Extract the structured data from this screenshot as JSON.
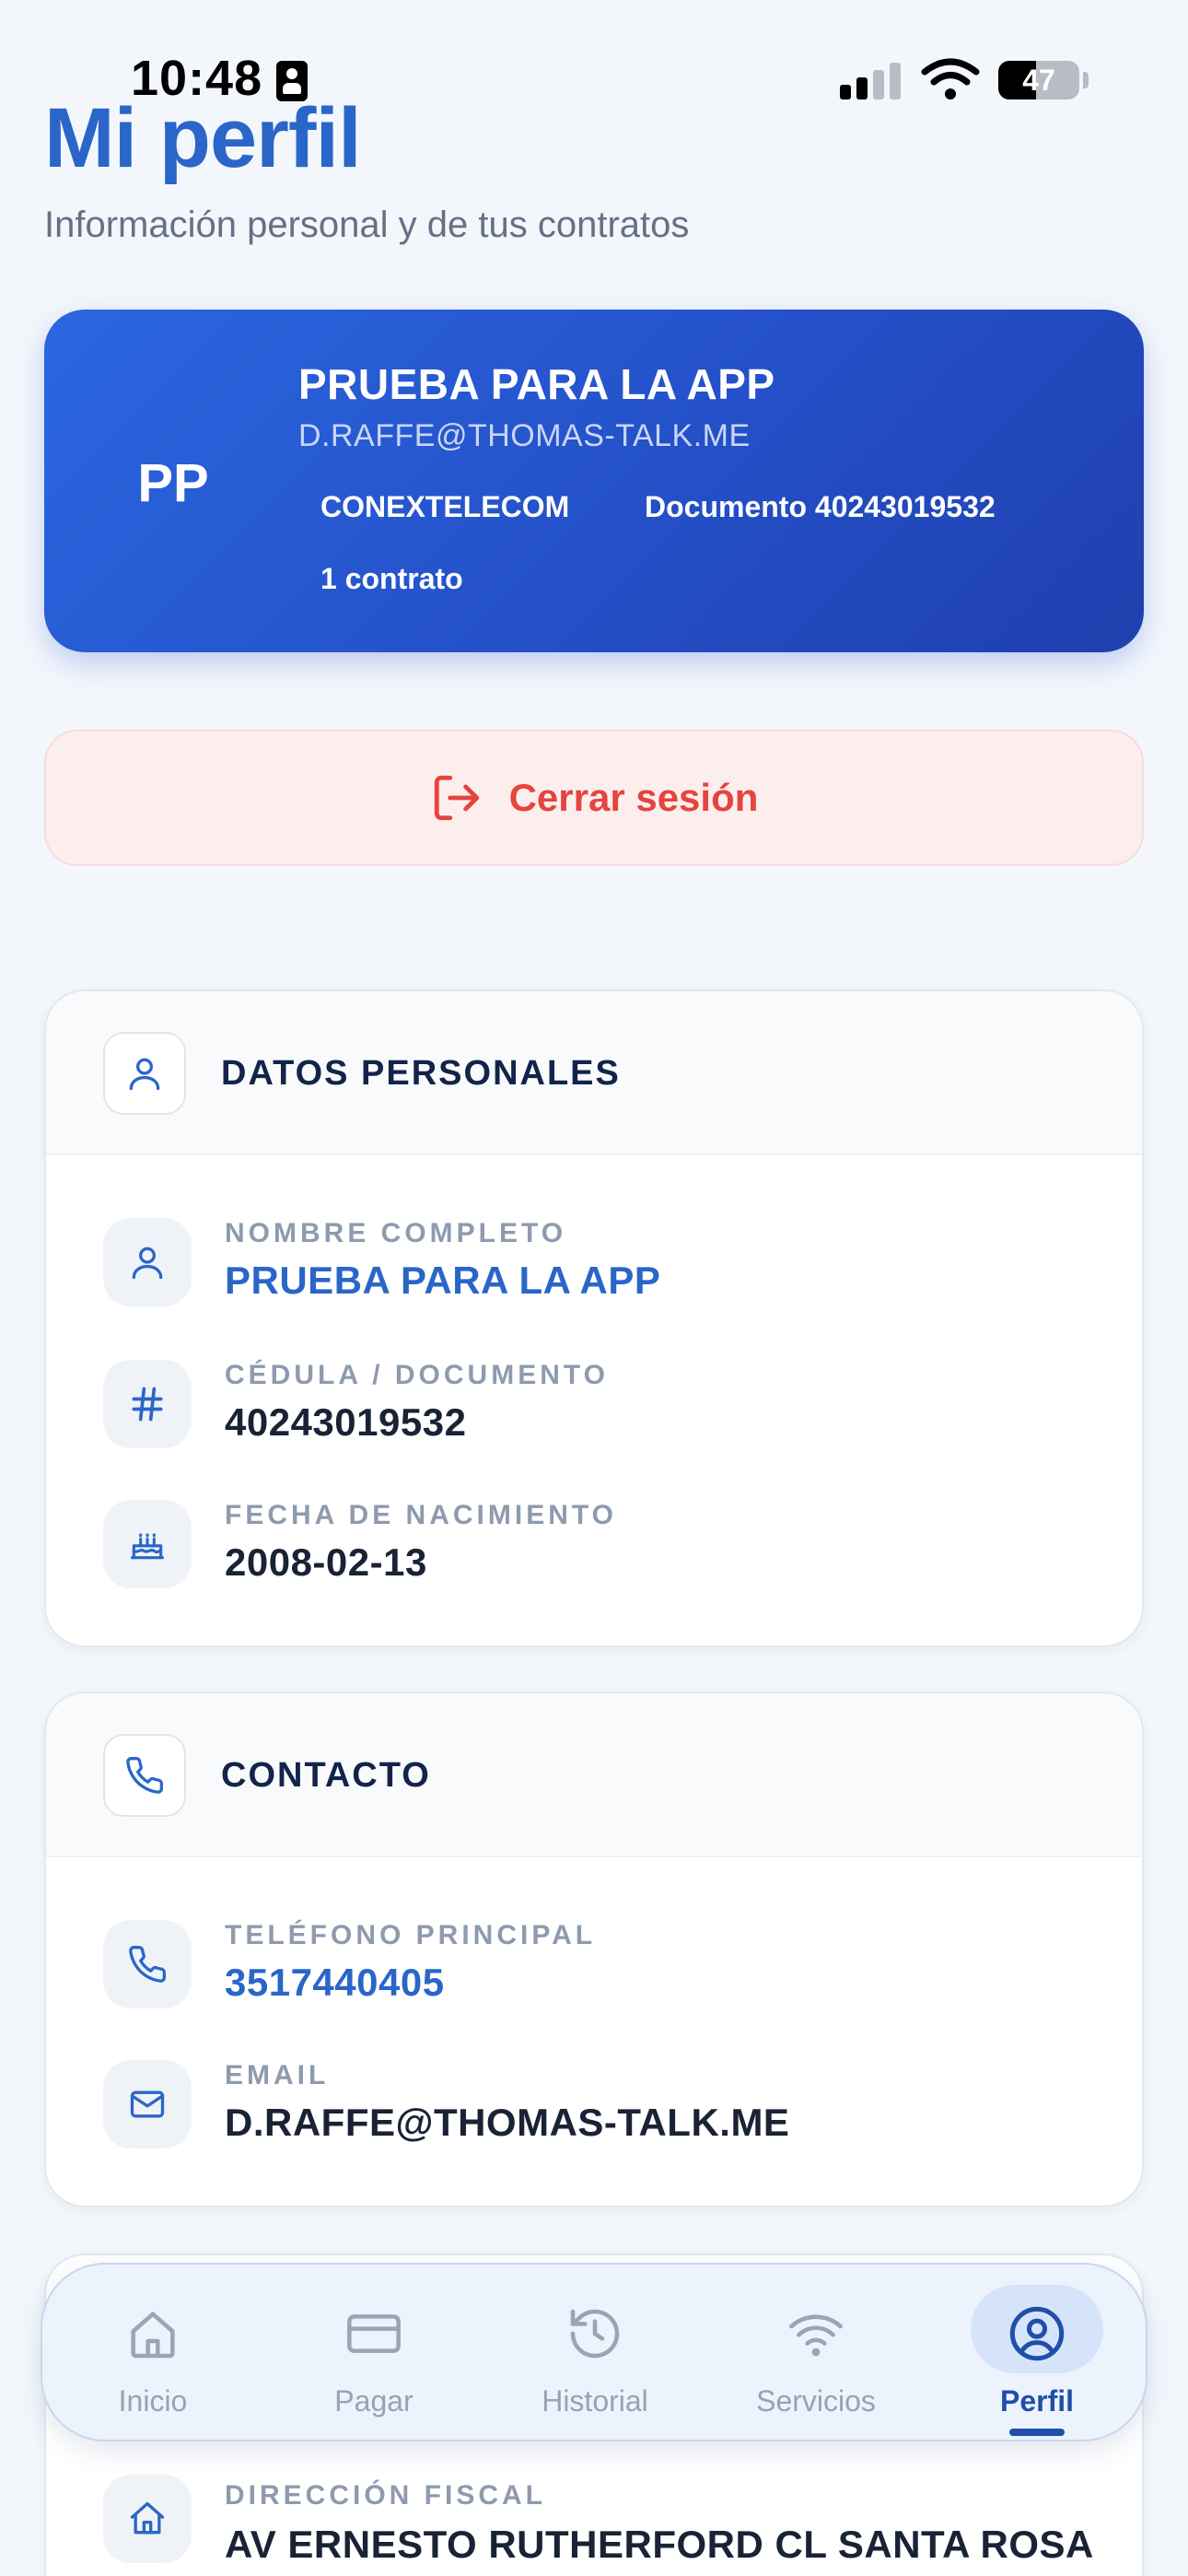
{
  "status": {
    "time": "10:48",
    "battery": "47",
    "battery_level": 0.47
  },
  "header": {
    "title": "Mi perfil",
    "subtitle": "Información personal y de tus contratos"
  },
  "profile": {
    "initials": "PP",
    "name": "PRUEBA PARA LA APP",
    "email": "D.RAFFE@THOMAS-TALK.ME",
    "company": "CONEXTELECOM",
    "document": "Documento 40243019532",
    "contracts": "1 contrato"
  },
  "logout": {
    "label": "Cerrar sesión"
  },
  "personal": {
    "title": "DATOS PERSONALES",
    "fields": [
      {
        "label": "NOMBRE COMPLETO",
        "value": "PRUEBA PARA LA APP",
        "icon": "user-icon"
      },
      {
        "label": "CÉDULA / DOCUMENTO",
        "value": "40243019532",
        "icon": "hash-icon"
      },
      {
        "label": "FECHA DE NACIMIENTO",
        "value": "2008-02-13",
        "icon": "cake-icon"
      }
    ]
  },
  "contact": {
    "title": "CONTACTO",
    "fields": [
      {
        "label": "TELÉFONO PRINCIPAL",
        "value": "3517440405",
        "icon": "phone-icon"
      },
      {
        "label": "EMAIL",
        "value": "D.RAFFE@THOMAS-TALK.ME",
        "icon": "mail-icon"
      }
    ]
  },
  "address": {
    "fields": [
      {
        "label": "DIRECCIÓN FISCAL",
        "value": "AV ERNESTO RUTHERFORD CL SANTA ROSA",
        "icon": "home-icon"
      }
    ]
  },
  "nav": {
    "items": [
      {
        "label": "Inicio",
        "icon": "home-icon"
      },
      {
        "label": "Pagar",
        "icon": "credit-card-icon"
      },
      {
        "label": "Historial",
        "icon": "history-icon"
      },
      {
        "label": "Servicios",
        "icon": "wifi-icon"
      },
      {
        "label": "Perfil",
        "icon": "user-circle-icon",
        "active": true
      }
    ]
  },
  "colors": {
    "brand": "#2a66c8",
    "danger": "#e5443f",
    "nav_active": "#1f4fa8"
  }
}
